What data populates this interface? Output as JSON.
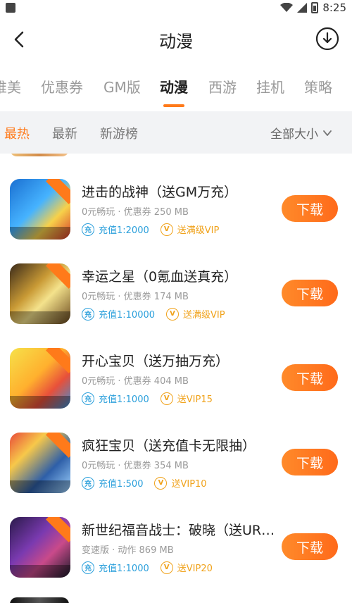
{
  "status": {
    "time": "8:25"
  },
  "header": {
    "title": "动漫"
  },
  "tabs": [
    {
      "label": "唯美"
    },
    {
      "label": "优惠券"
    },
    {
      "label": "GM版"
    },
    {
      "label": "动漫"
    },
    {
      "label": "西游"
    },
    {
      "label": "挂机"
    },
    {
      "label": "策略"
    }
  ],
  "filters": {
    "hot": "最热",
    "new": "最新",
    "rank": "新游榜",
    "size": "全部大小"
  },
  "games": [
    {
      "title": "进击的战神（送GM万充）",
      "meta": "0元畅玩 · 优惠券  250 MB",
      "recharge": "充值1:2000",
      "vip": "送满级VIP",
      "button": "下载"
    },
    {
      "title": "幸运之星（0氪血送真充）",
      "meta": "0元畅玩 · 优惠券  174 MB",
      "recharge": "充值1:10000",
      "vip": "送满级VIP",
      "button": "下载"
    },
    {
      "title": "开心宝贝（送万抽万充）",
      "meta": "0元畅玩 · 优惠券  404 MB",
      "recharge": "充值1:1000",
      "vip": "送VIP15",
      "button": "下载"
    },
    {
      "title": "疯狂宝贝（送充值卡无限抽）",
      "meta": "0元畅玩 · 优惠券  354 MB",
      "recharge": "充值1:500",
      "vip": "送VIP10",
      "button": "下载"
    },
    {
      "title": "新世纪福音战士：破晓（送UR…",
      "meta": "变速版 · 动作  869 MB",
      "recharge": "充值1:1000",
      "vip": "送VIP20",
      "button": "下载"
    }
  ],
  "icons": {
    "recharge_glyph": "充",
    "vip_glyph": "V"
  },
  "colors": {
    "accent": "#ff7a1a",
    "tag_blue": "#2a9fdb",
    "tag_orange": "#f0a21a"
  }
}
